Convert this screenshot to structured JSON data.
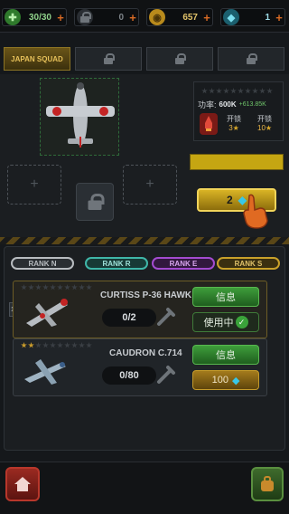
{
  "resources": {
    "energy": {
      "value": "30/30",
      "icon": "green-energy-icon"
    },
    "lock_resource": {
      "value": "0",
      "icon": "lock-icon"
    },
    "coins": {
      "value": "657",
      "icon": "coin-icon"
    },
    "gems": {
      "value": "1",
      "icon": "gem-icon"
    },
    "plus": "+"
  },
  "squads": {
    "active_label": "JAPAN SQUAD",
    "locked_count": 3
  },
  "plane_panel": {
    "power_label": "功率:",
    "power_value": "600K",
    "power_bonus": "+613.85K",
    "unlock1_label": "开锁",
    "unlock1_value": "3",
    "unlock2_label": "开锁",
    "unlock2_value": "10",
    "upgrade_value": "2"
  },
  "ranks": [
    {
      "label": "RANK N",
      "color": "#b8bcc0"
    },
    {
      "label": "RANK R",
      "color": "#3fb6a8"
    },
    {
      "label": "RANK E",
      "color": "#a34bd0"
    },
    {
      "label": "RANK S",
      "color": "#c9a12a"
    }
  ],
  "planes": [
    {
      "name": "CURTISS P-36 HAWK",
      "count": "0/2",
      "stars": 0,
      "info_label": "信息",
      "action_label": "使用中",
      "side_label": "1"
    },
    {
      "name": "CAUDRON C.714",
      "count": "0/80",
      "stars": 2,
      "info_label": "信息",
      "action_label": "100"
    }
  ],
  "colors": {
    "accent_gold": "#c9a12a",
    "accent_green": "#3e9d3b",
    "accent_red": "#9a2a21"
  }
}
